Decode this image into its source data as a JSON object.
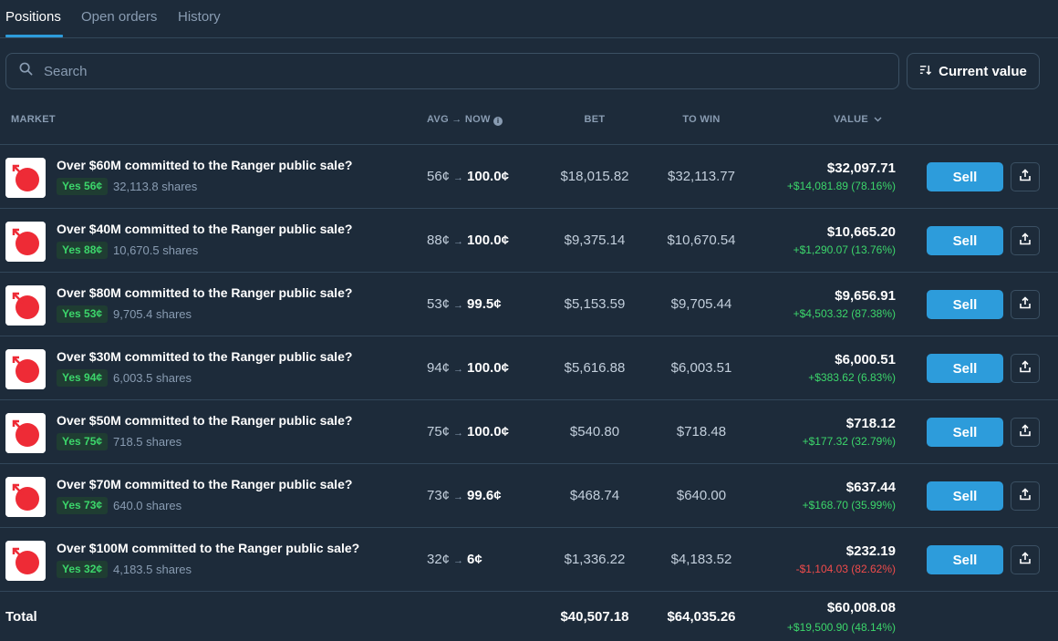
{
  "tabs": [
    {
      "label": "Positions",
      "active": true
    },
    {
      "label": "Open orders",
      "active": false
    },
    {
      "label": "History",
      "active": false
    }
  ],
  "search": {
    "placeholder": "Search",
    "value": ""
  },
  "sort": {
    "label": "Current value"
  },
  "columns": {
    "market": "MARKET",
    "avg_now": "AVG → NOW",
    "bet": "BET",
    "to_win": "TO WIN",
    "value": "VALUE"
  },
  "rows": [
    {
      "title": "Over $60M committed to the Ranger public sale?",
      "outcome": "Yes 56¢",
      "shares": "32,113.8 shares",
      "avg": "56¢",
      "now": "100.0¢",
      "bet": "$18,015.82",
      "to_win": "$32,113.77",
      "value": "$32,097.71",
      "pnl": "+$14,081.89 (78.16%)",
      "pnl_positive": true,
      "sell_label": "Sell"
    },
    {
      "title": "Over $40M committed to the Ranger public sale?",
      "outcome": "Yes 88¢",
      "shares": "10,670.5 shares",
      "avg": "88¢",
      "now": "100.0¢",
      "bet": "$9,375.14",
      "to_win": "$10,670.54",
      "value": "$10,665.20",
      "pnl": "+$1,290.07 (13.76%)",
      "pnl_positive": true,
      "sell_label": "Sell"
    },
    {
      "title": "Over $80M committed to the Ranger public sale?",
      "outcome": "Yes 53¢",
      "shares": "9,705.4 shares",
      "avg": "53¢",
      "now": "99.5¢",
      "bet": "$5,153.59",
      "to_win": "$9,705.44",
      "value": "$9,656.91",
      "pnl": "+$4,503.32 (87.38%)",
      "pnl_positive": true,
      "sell_label": "Sell"
    },
    {
      "title": "Over $30M committed to the Ranger public sale?",
      "outcome": "Yes 94¢",
      "shares": "6,003.5 shares",
      "avg": "94¢",
      "now": "100.0¢",
      "bet": "$5,616.88",
      "to_win": "$6,003.51",
      "value": "$6,000.51",
      "pnl": "+$383.62 (6.83%)",
      "pnl_positive": true,
      "sell_label": "Sell"
    },
    {
      "title": "Over $50M committed to the Ranger public sale?",
      "outcome": "Yes 75¢",
      "shares": "718.5 shares",
      "avg": "75¢",
      "now": "100.0¢",
      "bet": "$540.80",
      "to_win": "$718.48",
      "value": "$718.12",
      "pnl": "+$177.32 (32.79%)",
      "pnl_positive": true,
      "sell_label": "Sell"
    },
    {
      "title": "Over $70M committed to the Ranger public sale?",
      "outcome": "Yes 73¢",
      "shares": "640.0 shares",
      "avg": "73¢",
      "now": "99.6¢",
      "bet": "$468.74",
      "to_win": "$640.00",
      "value": "$637.44",
      "pnl": "+$168.70 (35.99%)",
      "pnl_positive": true,
      "sell_label": "Sell"
    },
    {
      "title": "Over $100M committed to the Ranger public sale?",
      "outcome": "Yes 32¢",
      "shares": "4,183.5 shares",
      "avg": "32¢",
      "now": "6¢",
      "bet": "$1,336.22",
      "to_win": "$4,183.52",
      "value": "$232.19",
      "pnl": "-$1,104.03 (82.62%)",
      "pnl_positive": false,
      "sell_label": "Sell"
    }
  ],
  "totals": {
    "label": "Total",
    "bet": "$40,507.18",
    "to_win": "$64,035.26",
    "value": "$60,008.08",
    "pnl": "+$19,500.90 (48.14%)"
  },
  "colors": {
    "background": "#1d2b3a",
    "accent": "#2d9cdb",
    "positive": "#3cd66b",
    "negative": "#f04b4b",
    "muted": "#899cb2"
  }
}
